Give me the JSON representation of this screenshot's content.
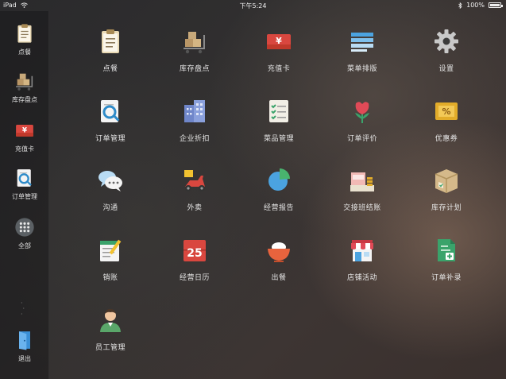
{
  "status_bar": {
    "device": "iPad",
    "time": "下午5:24",
    "battery": "100%"
  },
  "sidebar": {
    "items": [
      {
        "label": "点餐",
        "icon": "clipboard-icon"
      },
      {
        "label": "库存盘点",
        "icon": "boxes-cart-icon"
      },
      {
        "label": "充值卡",
        "icon": "yen-card-icon"
      },
      {
        "label": "订单管理",
        "icon": "search-document-icon"
      },
      {
        "label": "全部",
        "icon": "grid-dots-icon"
      }
    ],
    "logout_label": "退出"
  },
  "grid": {
    "items": [
      {
        "label": "点餐",
        "icon": "clipboard-icon"
      },
      {
        "label": "库存盘点",
        "icon": "boxes-cart-icon"
      },
      {
        "label": "充值卡",
        "icon": "yen-card-icon"
      },
      {
        "label": "菜单排版",
        "icon": "menu-layout-icon"
      },
      {
        "label": "设置",
        "icon": "gear-icon"
      },
      {
        "label": "订单管理",
        "icon": "search-document-icon"
      },
      {
        "label": "企业折扣",
        "icon": "buildings-icon"
      },
      {
        "label": "菜品管理",
        "icon": "checklist-icon"
      },
      {
        "label": "订单评价",
        "icon": "flower-icon"
      },
      {
        "label": "优惠券",
        "icon": "coupon-icon"
      },
      {
        "label": "沟通",
        "icon": "chat-bubbles-icon"
      },
      {
        "label": "外卖",
        "icon": "scooter-icon"
      },
      {
        "label": "经营报告",
        "icon": "pie-chart-icon"
      },
      {
        "label": "交接班结账",
        "icon": "cash-register-icon"
      },
      {
        "label": "库存计划",
        "icon": "package-icon"
      },
      {
        "label": "销账",
        "icon": "write-off-icon"
      },
      {
        "label": "经营日历",
        "icon": "calendar-icon"
      },
      {
        "label": "出餐",
        "icon": "bowl-icon"
      },
      {
        "label": "店铺活动",
        "icon": "storefront-icon"
      },
      {
        "label": "订单补录",
        "icon": "document-add-icon"
      },
      {
        "label": "员工管理",
        "icon": "person-icon"
      }
    ],
    "calendar_day": "25"
  }
}
